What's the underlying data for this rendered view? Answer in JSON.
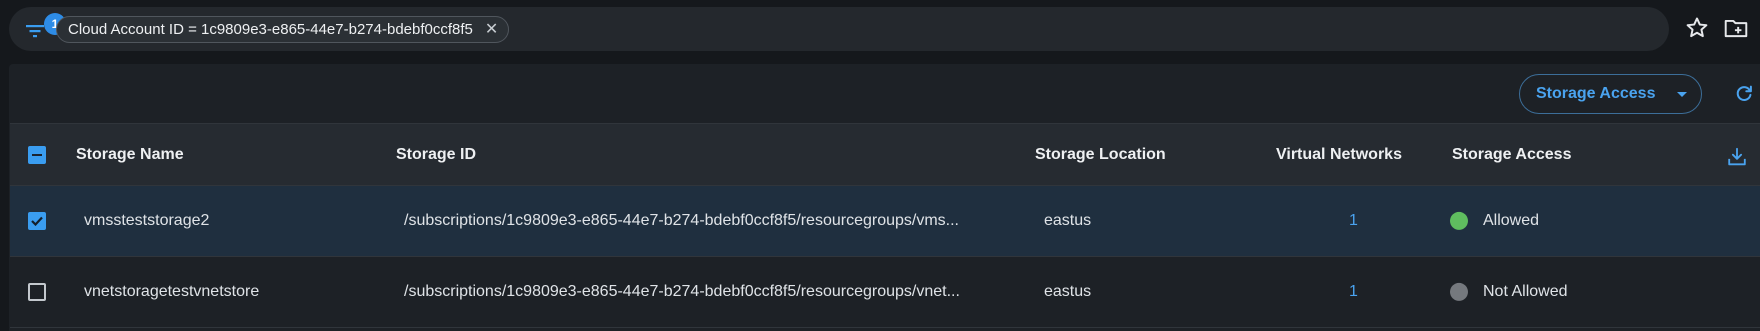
{
  "filter_bar": {
    "badge_count": "1",
    "chip_label": "Cloud Account ID = 1c9809e3-e865-44e7-b274-bdebf0ccf8f5",
    "chip_close": "✕"
  },
  "toolbar": {
    "storage_access_label": "Storage Access"
  },
  "table": {
    "columns": [
      "Storage Name",
      "Storage ID",
      "Storage Location",
      "Virtual Networks",
      "Storage Access"
    ],
    "rows": [
      {
        "selected": true,
        "name": "vmssteststorage2",
        "id": "/subscriptions/1c9809e3-e865-44e7-b274-bdebf0ccf8f5/resourcegroups/vms...",
        "location": "eastus",
        "virtual_networks": "1",
        "access": "Allowed",
        "access_color": "#5fbd5f"
      },
      {
        "selected": false,
        "name": "vnetstoragetestvnetstore",
        "id": "/subscriptions/1c9809e3-e865-44e7-b274-bdebf0ccf8f5/resourcegroups/vnet...",
        "location": "eastus",
        "virtual_networks": "1",
        "access": "Not Allowed",
        "access_color": "#75797e"
      }
    ]
  },
  "colors": {
    "accent": "#4aa3ef",
    "background": "#15181c",
    "selected_row": "#1f2f3f"
  }
}
